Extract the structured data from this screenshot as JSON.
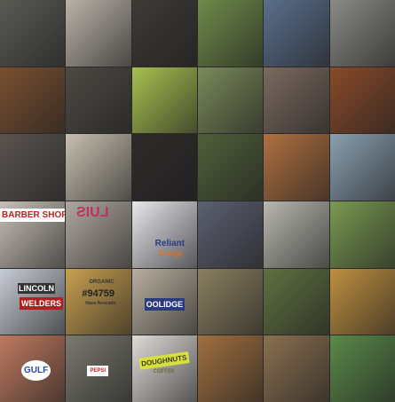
{
  "tiles": [
    {
      "subject": "grater"
    },
    {
      "subject": "typewriter"
    },
    {
      "subject": "typewriter-black"
    },
    {
      "subject": "park-statue"
    },
    {
      "subject": "woman-blue-dress"
    },
    {
      "subject": "penguins"
    },
    {
      "subject": "dog-with-grater"
    },
    {
      "subject": "typewriter-keys"
    },
    {
      "subject": "colander"
    },
    {
      "subject": "man-red-shirt"
    },
    {
      "subject": "man-portrait"
    },
    {
      "subject": "red-setter"
    },
    {
      "subject": "grate"
    },
    {
      "subject": "bowl-of-nuts"
    },
    {
      "subject": "patterned-dress"
    },
    {
      "subject": "people-lawn"
    },
    {
      "subject": "boxer-dog"
    },
    {
      "subject": "sailboats"
    },
    {
      "subject": "barber-shop",
      "text": "BARBER SHOP"
    },
    {
      "subject": "luis-sign",
      "text": "LUIS"
    },
    {
      "subject": "reliant-shirt",
      "text": "Reliant",
      "text2": "Energy"
    },
    {
      "subject": "border-collie"
    },
    {
      "subject": "collie-pair"
    },
    {
      "subject": "sheltie"
    },
    {
      "subject": "lincoln-welders",
      "text": "LINCOLN",
      "text2": "WELDERS"
    },
    {
      "subject": "avocado-sticker",
      "text": "ORGANIC",
      "text2": "#94759",
      "text3": "Hass Avocado"
    },
    {
      "subject": "thimble",
      "text": "OOLIDGE"
    },
    {
      "subject": "german-shepherd"
    },
    {
      "subject": "dog-grass"
    },
    {
      "subject": "pomeranian"
    },
    {
      "subject": "gulf-pump",
      "text": "GULF"
    },
    {
      "subject": "pepsi-bottle",
      "text": "PEPSI"
    },
    {
      "subject": "doughnut-mug",
      "text": "DOUGHNUTS",
      "text2": "COFFEE"
    },
    {
      "subject": "fox"
    },
    {
      "subject": "small-dog"
    },
    {
      "subject": "sheepdog"
    }
  ],
  "colors": [
    "#5a5a55",
    "#b9b2a8",
    "#3d3a36",
    "#6f8a4a",
    "#5b6f8c",
    "#8a8a86",
    "#7a5030",
    "#4c4a44",
    "#a8c050",
    "#7b8a5a",
    "#7a6a60",
    "#8a4a2a",
    "#5a5450",
    "#c7c0b0",
    "#2e2a2a",
    "#50603a",
    "#b07040",
    "#8aa0b0",
    "#c8c0b8",
    "#b0a8a0",
    "#e8e8ec",
    "#5c6070",
    "#b8b8b0",
    "#7a9a50",
    "#c8ccd4",
    "#c8a050",
    "#b8b0a0",
    "#8a8060",
    "#607040",
    "#c09040",
    "#c07a60",
    "#7a7a70",
    "#e0dcd8",
    "#a07040",
    "#8a7050",
    "#5a8a4a"
  ]
}
